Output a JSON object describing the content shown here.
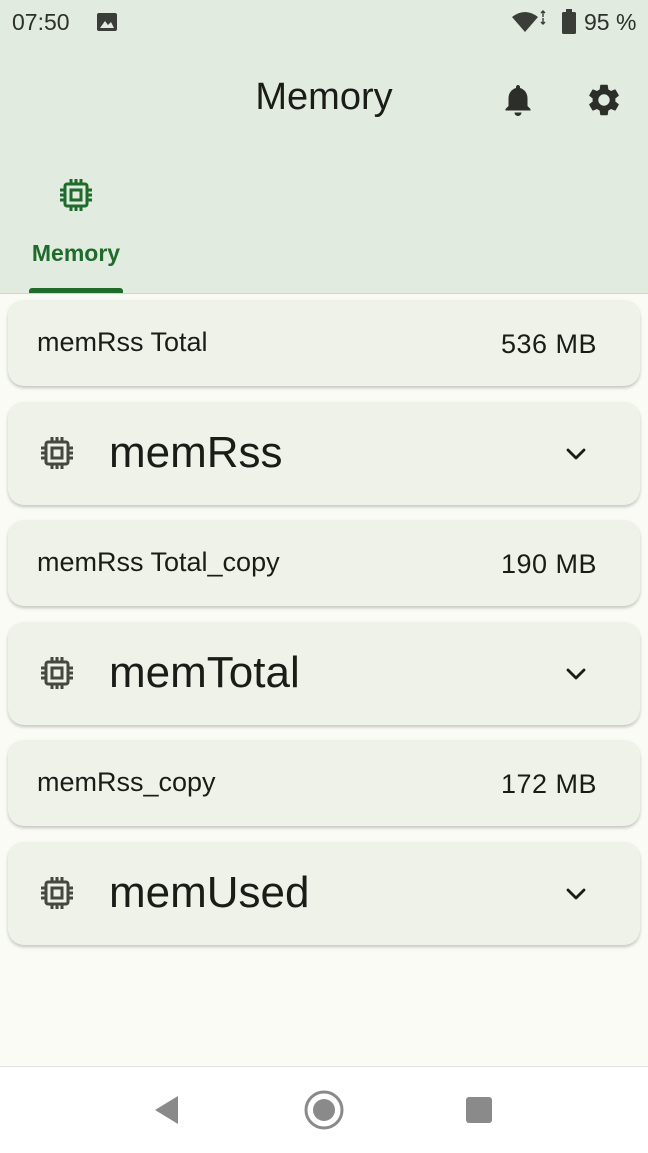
{
  "status_bar": {
    "time": "07:50",
    "battery": "95 %",
    "icons": [
      "image-icon",
      "wifi-icon",
      "battery-icon"
    ]
  },
  "app_bar": {
    "title": "Memory",
    "actions": [
      "bell-icon",
      "gear-icon"
    ]
  },
  "tabs": [
    {
      "label": "Memory",
      "icon": "chip-icon",
      "selected": true
    }
  ],
  "items": [
    {
      "type": "summary",
      "label": "memRss Total",
      "value": "536 MB"
    },
    {
      "type": "group",
      "title": "memRss",
      "icon": "chip-icon",
      "expand_icon": "chevron-down-icon"
    },
    {
      "type": "summary",
      "label": "memRss Total_copy",
      "value": "190 MB"
    },
    {
      "type": "group",
      "title": "memTotal",
      "icon": "chip-icon",
      "expand_icon": "chevron-down-icon"
    },
    {
      "type": "summary",
      "label": "memRss_copy",
      "value": "172 MB"
    },
    {
      "type": "group",
      "title": "memUsed",
      "icon": "chip-icon",
      "expand_icon": "chevron-down-icon"
    }
  ],
  "nav_bar": [
    "back-icon",
    "home-icon",
    "recents-icon"
  ],
  "colors": {
    "accent": "#1e6b2b",
    "header_bg": "#e1ebdf",
    "card_bg": "#eef2e8",
    "page_bg": "#fafbf5"
  }
}
